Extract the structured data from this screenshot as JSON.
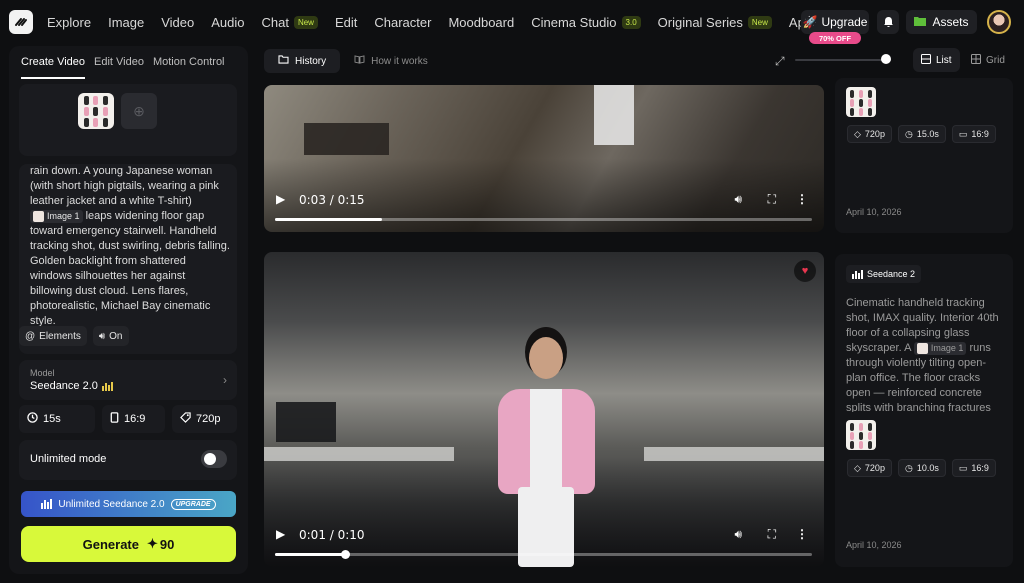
{
  "nav": {
    "items": [
      {
        "label": "Explore"
      },
      {
        "label": "Image"
      },
      {
        "label": "Video"
      },
      {
        "label": "Audio"
      },
      {
        "label": "Chat",
        "tag": "New"
      },
      {
        "label": "Edit"
      },
      {
        "label": "Character"
      },
      {
        "label": "Moodboard"
      },
      {
        "label": "Cinema Studio",
        "tag": "3.0"
      },
      {
        "label": "Original Series",
        "tag": "New"
      },
      {
        "label": "Apps"
      }
    ],
    "upgrade_label": "Upgrade",
    "upgrade_badge": "70% OFF",
    "assets_label": "Assets"
  },
  "left_panel": {
    "tabs": [
      "Create Video",
      "Edit Video",
      "Motion Control"
    ],
    "active_tab": "Create Video",
    "prompt_before": "rain down.  A young Japanese woman (with short high pigtails, wearing a pink leather jacket and a white T-shirt)",
    "prompt_chip": "Image 1",
    "prompt_after": "leaps widening floor gap toward emergency stairwell. Handheld tracking shot, dust swirling, debris falling. Golden backlight from shattered windows silhouettes her against billowing dust cloud. Lens flares, photorealistic, Michael Bay cinematic style.",
    "elements_label": "Elements",
    "audio_label": "On",
    "model_label": "Model",
    "model_value": "Seedance 2.0",
    "duration": "15s",
    "aspect": "16:9",
    "resolution": "720p",
    "unlimited_label": "Unlimited mode",
    "unlimited_on": false,
    "promo_label": "Unlimited Seedance 2.0",
    "promo_badge": "UPGRADE",
    "generate_label": "Generate",
    "generate_cost": "90"
  },
  "toolbar": {
    "tabs": [
      "History",
      "How it works"
    ],
    "active_tab": "History",
    "view_list": "List",
    "view_grid": "Grid",
    "zoom_level": 0.95
  },
  "videos": [
    {
      "time": "0:03 / 0:15",
      "progress": 0.2,
      "liked": false
    },
    {
      "time": "0:01 / 0:10",
      "progress": 0.13,
      "liked": true
    }
  ],
  "cards": [
    {
      "resolution": "720p",
      "duration": "15.0s",
      "aspect": "16:9",
      "date": "April 10, 2026"
    },
    {
      "model": "Seedance 2",
      "prompt_before": "Cinematic handheld tracking shot, IMAX quality. Interior 40th floor of a collapsing glass skyscraper. A",
      "prompt_chip": "Image 1",
      "prompt_after": "runs through violently tilting open-plan office. The floor cracks open — reinforced concrete splits with branching fractures",
      "resolution": "720p",
      "duration": "10.0s",
      "aspect": "16:9",
      "date": "April 10, 2026"
    }
  ],
  "colors": {
    "accent_lime": "#d8f93a",
    "promo_gradient_start": "#3654c9",
    "promo_gradient_end": "#4aa6c6",
    "badge_pink": "#e84b8a",
    "heart_red": "#e8364f"
  }
}
